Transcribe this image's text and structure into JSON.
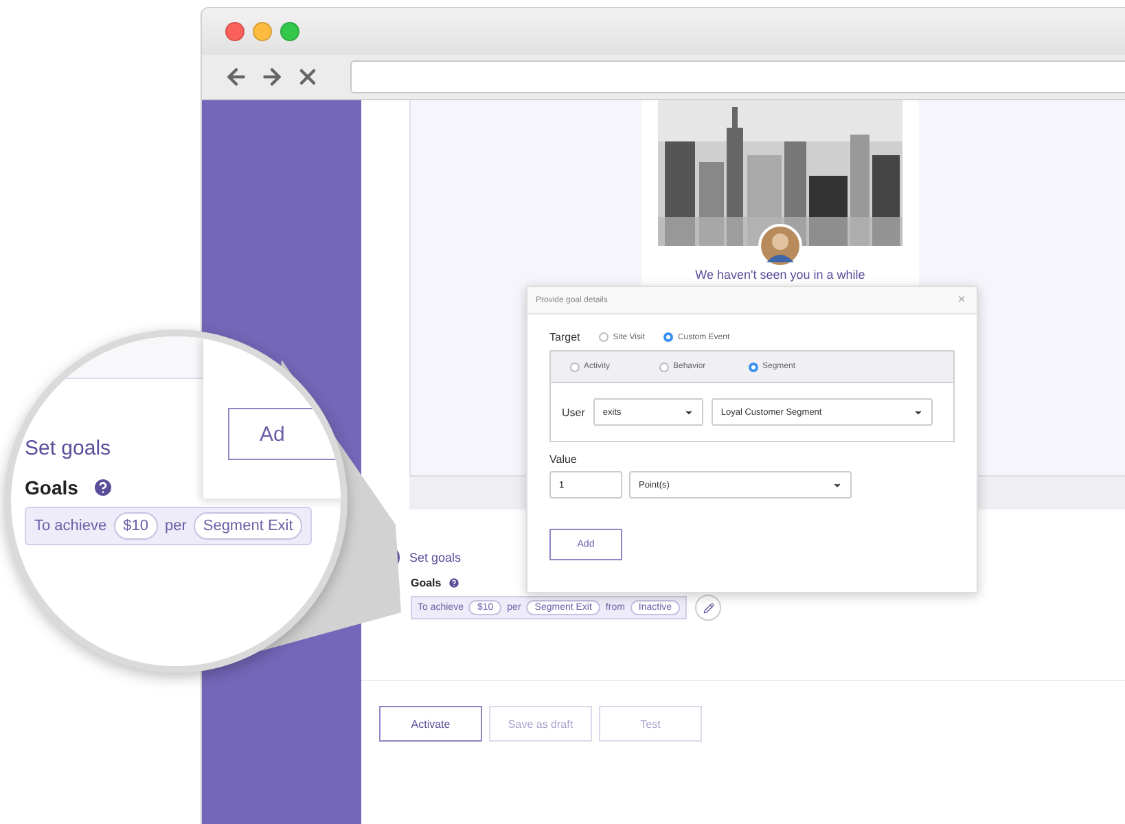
{
  "preview": {
    "kind": "picture",
    "headline": "We haven't seen you in a while"
  },
  "step": {
    "title": "Set goals"
  },
  "goals": {
    "label": "Goals",
    "sentence": [
      {
        "kind": "word",
        "text": "To achieve"
      },
      {
        "kind": "chip",
        "text": "$10"
      },
      {
        "kind": "word",
        "text": "per"
      },
      {
        "kind": "chip",
        "text": "Segment Exit"
      },
      {
        "kind": "word",
        "text": "from"
      },
      {
        "kind": "chip",
        "text": "Inactive"
      }
    ]
  },
  "actions": [
    {
      "label": "Activate",
      "primary": true
    },
    {
      "label": "Save as draft",
      "primary": false
    },
    {
      "label": "Test",
      "primary": false
    }
  ],
  "modal": {
    "title": "Provide goal details",
    "close": "×",
    "target_label": "Target",
    "targets": [
      {
        "label": "Site Visit",
        "selected": false
      },
      {
        "label": "Custom Event",
        "selected": true
      }
    ],
    "sources": [
      {
        "label": "Activity",
        "selected": false
      },
      {
        "label": "Behavior",
        "selected": false
      },
      {
        "label": "Segment",
        "selected": true
      }
    ],
    "user_label": "User",
    "action_select": "exits",
    "segment_select": "Loyal Customer Segment",
    "value_label": "Value",
    "value": "1",
    "unit_select": "Point(s)",
    "add_button": "Add"
  },
  "magnifier": {
    "step_title": "Set goals",
    "goals_label": "Goals",
    "sentence": [
      {
        "kind": "word",
        "text": "To achieve"
      },
      {
        "kind": "chip",
        "text": "$10"
      },
      {
        "kind": "word",
        "text": "per"
      },
      {
        "kind": "chip",
        "text": "Segment Exit"
      }
    ],
    "button": "Ad"
  }
}
